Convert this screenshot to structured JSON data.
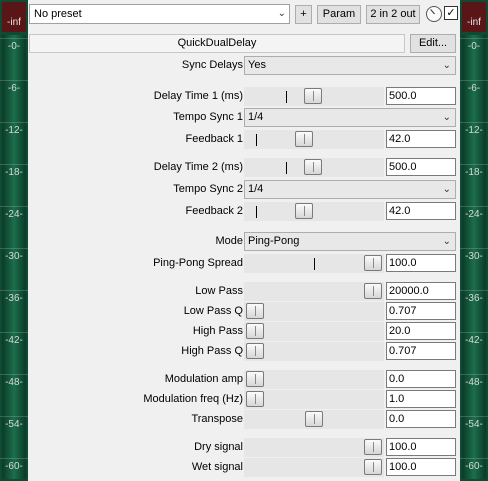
{
  "meters": {
    "peak_label": "-inf",
    "ticks": [
      "-0-",
      "-6-",
      "-12-",
      "-18-",
      "-24-",
      "-30-",
      "-36-",
      "-42-",
      "-48-",
      "-54-",
      "-60-"
    ]
  },
  "topbar": {
    "preset": "No preset",
    "plus_label": "+",
    "param_label": "Param",
    "io_label": "2 in 2 out",
    "bypass_checked": true,
    "check_glyph": "✓"
  },
  "plugin": {
    "name": "QuickDualDelay",
    "edit_label": "Edit..."
  },
  "params": {
    "sync_delays": {
      "label": "Sync Delays",
      "value": "Yes"
    },
    "delay_time_1": {
      "label": "Delay Time 1 (ms)",
      "value": "500.0"
    },
    "tempo_sync_1": {
      "label": "Tempo Sync 1",
      "value": "1/4"
    },
    "feedback_1": {
      "label": "Feedback 1",
      "value": "42.0"
    },
    "delay_time_2": {
      "label": "Delay Time 2 (ms)",
      "value": "500.0"
    },
    "tempo_sync_2": {
      "label": "Tempo Sync 2",
      "value": "1/4"
    },
    "feedback_2": {
      "label": "Feedback 2",
      "value": "42.0"
    },
    "mode": {
      "label": "Mode",
      "value": "Ping-Pong"
    },
    "pingpong_spread": {
      "label": "Ping-Pong Spread",
      "value": "100.0"
    },
    "low_pass": {
      "label": "Low Pass",
      "value": "20000.0"
    },
    "low_pass_q": {
      "label": "Low Pass Q",
      "value": "0.707"
    },
    "high_pass": {
      "label": "High Pass",
      "value": "20.0"
    },
    "high_pass_q": {
      "label": "High Pass Q",
      "value": "0.707"
    },
    "mod_amp": {
      "label": "Modulation amp",
      "value": "0.0"
    },
    "mod_freq": {
      "label": "Modulation freq (Hz)",
      "value": "1.0"
    },
    "transpose": {
      "label": "Transpose",
      "value": "0.0"
    },
    "dry_signal": {
      "label": "Dry signal",
      "value": "100.0"
    },
    "wet_signal": {
      "label": "Wet signal",
      "value": "100.0"
    }
  },
  "icons": {
    "dropdown": "chevron-down-icon",
    "knob": "wet-knob-icon",
    "check": "checkmark-icon"
  }
}
